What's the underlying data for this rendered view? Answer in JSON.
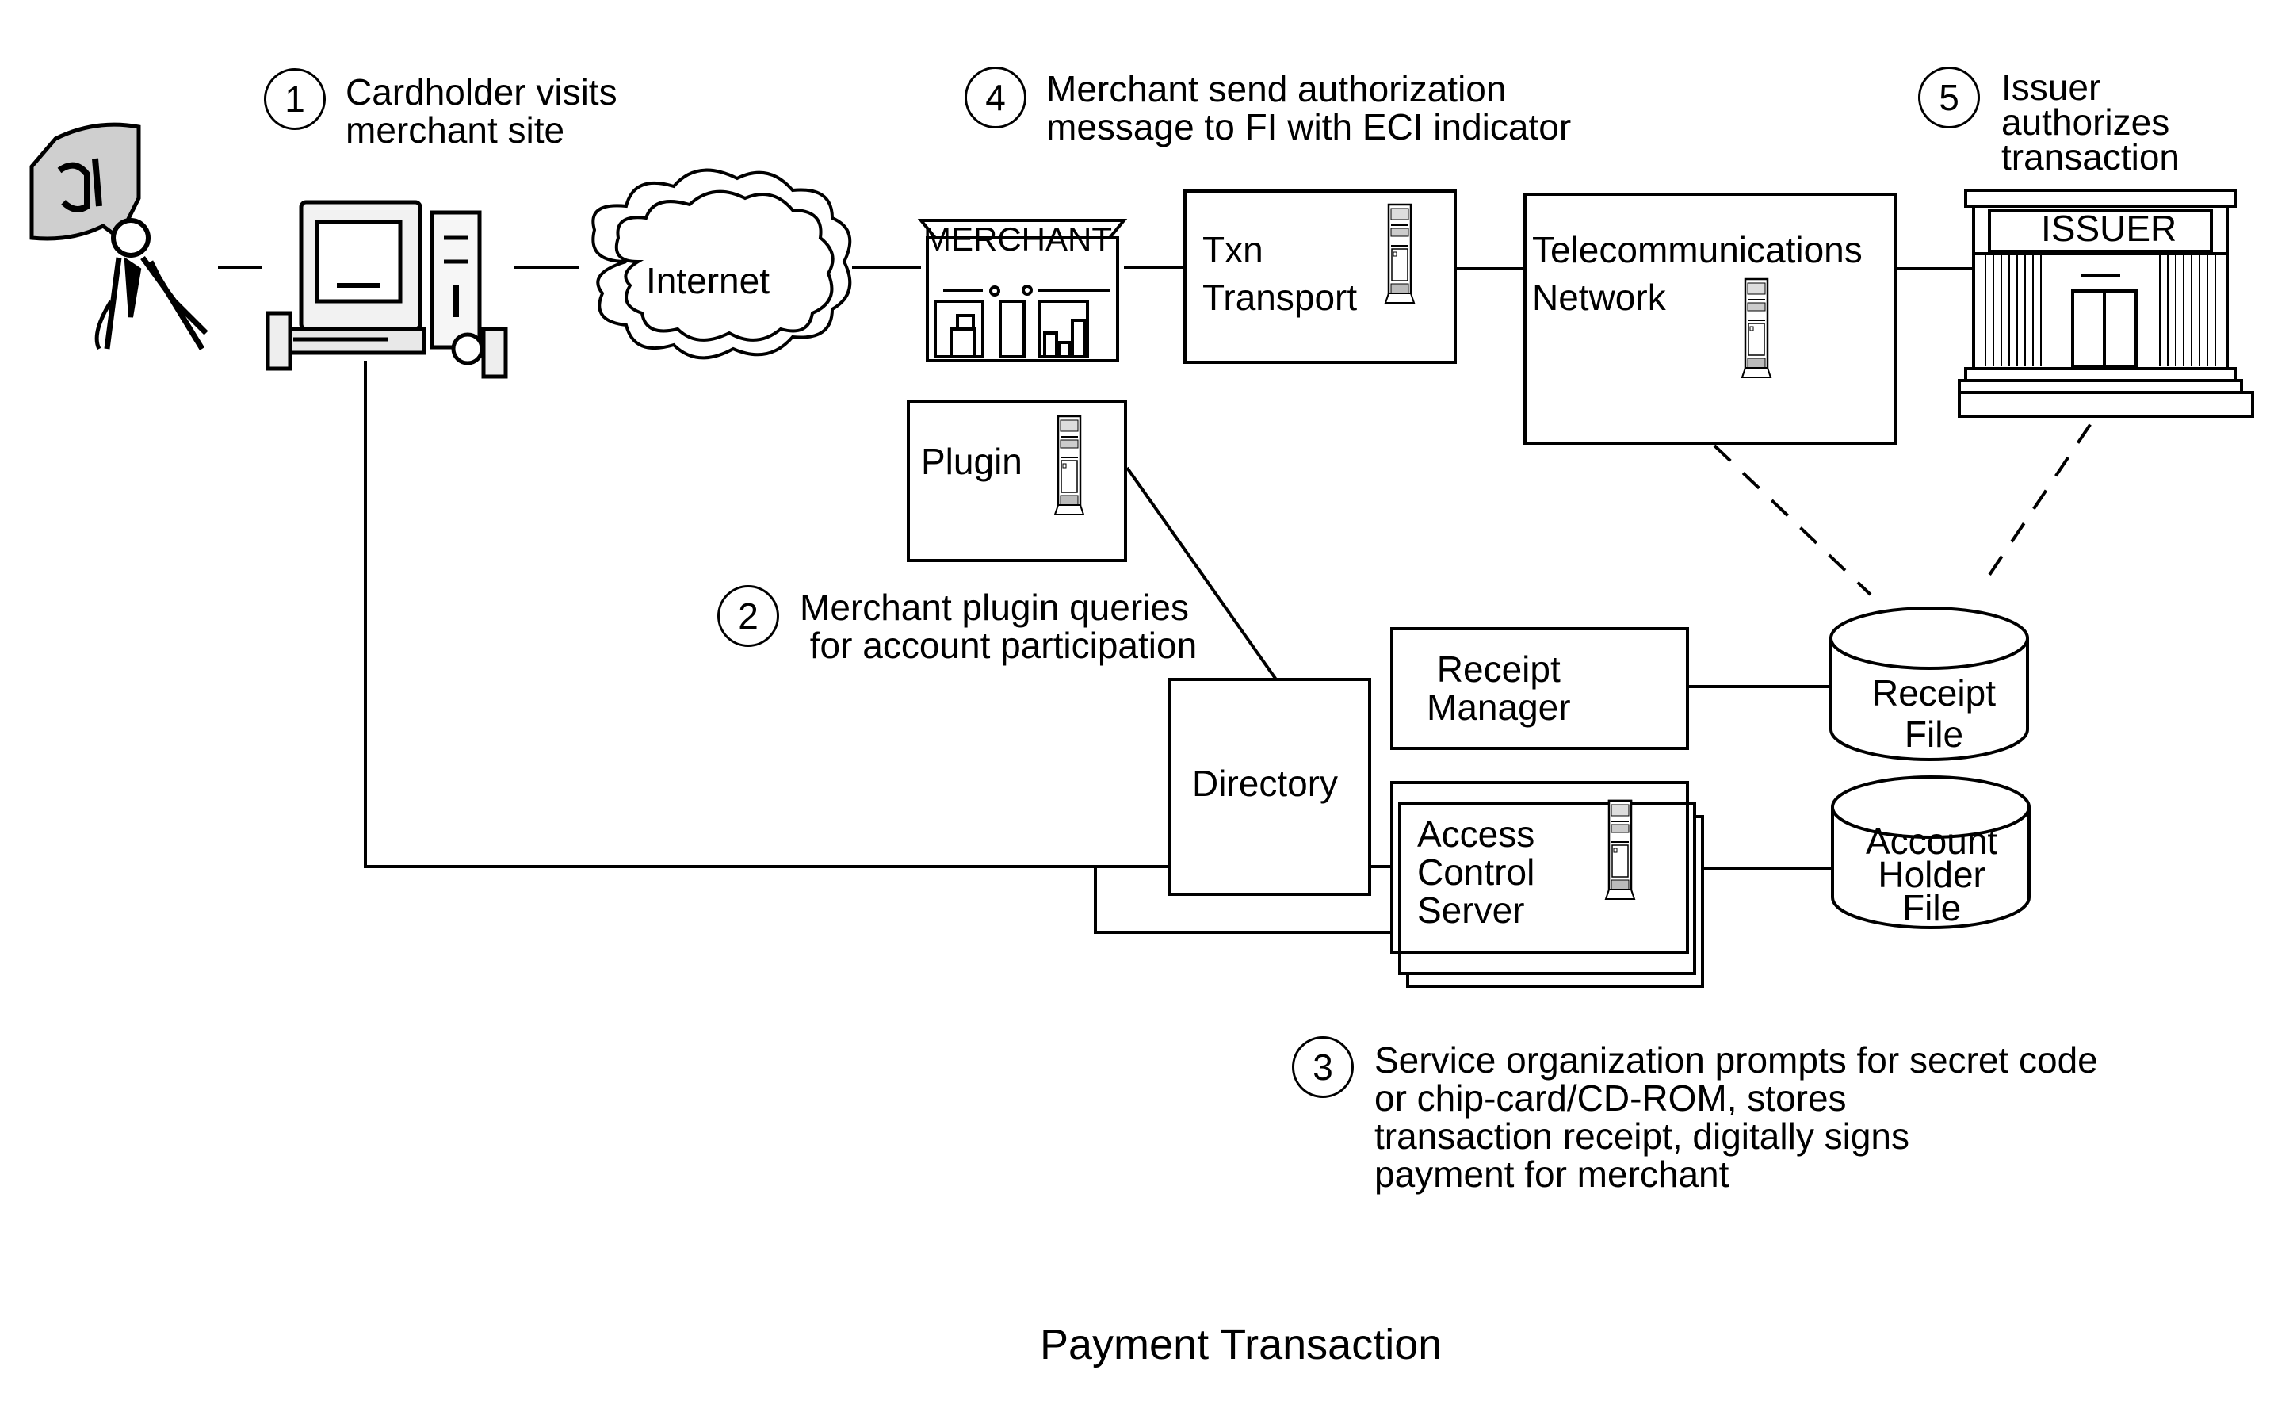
{
  "caption": "Payment Transaction",
  "steps": [
    {
      "number": "1",
      "text": "Cardholder visits\nmerchant site"
    },
    {
      "number": "2",
      "text": "Merchant plugin queries\n for account participation"
    },
    {
      "number": "3",
      "text": "Service organization prompts for secret code\nor chip-card/CD-ROM, stores\ntransaction receipt, digitally signs\npayment for merchant"
    },
    {
      "number": "4",
      "text": "Merchant send authorization\nmessage to FI with ECI indicator"
    },
    {
      "number": "5",
      "text": "Issuer\nauthorizes\ntransaction"
    }
  ],
  "nodes": {
    "cardholder": {
      "label": "",
      "icon": "person-with-money-icon"
    },
    "computer": {
      "label": "",
      "icon": "desktop-computer-icon"
    },
    "internet": {
      "label": "Internet",
      "icon": "cloud-icon"
    },
    "merchant": {
      "label": "MERCHANT",
      "icon": "storefront-icon"
    },
    "txn_transport": {
      "label": "Txn\nTransport",
      "icon": "server-tower-icon"
    },
    "telecom": {
      "label": "Telecommunications\nNetwork",
      "icon": "server-tower-icon"
    },
    "issuer": {
      "label": "ISSUER",
      "icon": "bank-building-icon"
    },
    "plugin": {
      "label": "Plugin",
      "icon": "server-tower-icon"
    },
    "directory": {
      "label": "Directory"
    },
    "receipt_manager": {
      "label": "Receipt\nManager"
    },
    "access_control_server": {
      "label": "Access\nControl\nServer",
      "icon": "server-tower-icon"
    },
    "receipt_file": {
      "label": "Receipt\nFile",
      "icon": "database-cylinder-icon"
    },
    "account_holder_file": {
      "label": "Account\nHolder\nFile",
      "icon": "database-cylinder-icon"
    }
  },
  "connections": [
    {
      "from": "cardholder",
      "to": "computer",
      "style": "solid"
    },
    {
      "from": "computer",
      "to": "internet",
      "style": "solid"
    },
    {
      "from": "internet",
      "to": "merchant",
      "style": "solid"
    },
    {
      "from": "merchant",
      "to": "txn_transport",
      "style": "solid"
    },
    {
      "from": "txn_transport",
      "to": "telecom",
      "style": "solid"
    },
    {
      "from": "telecom",
      "to": "issuer",
      "style": "solid"
    },
    {
      "from": "plugin",
      "to": "directory",
      "style": "solid"
    },
    {
      "from": "computer",
      "to": "directory",
      "style": "solid"
    },
    {
      "from": "computer",
      "to": "access_control_server",
      "style": "solid"
    },
    {
      "from": "directory",
      "to": "access_control_server",
      "style": "solid"
    },
    {
      "from": "receipt_manager",
      "to": "receipt_file",
      "style": "solid"
    },
    {
      "from": "access_control_server",
      "to": "account_holder_file",
      "style": "solid"
    },
    {
      "from": "telecom",
      "to": "receipt_file",
      "style": "dashed"
    },
    {
      "from": "issuer",
      "to": "receipt_file",
      "style": "dashed"
    }
  ]
}
